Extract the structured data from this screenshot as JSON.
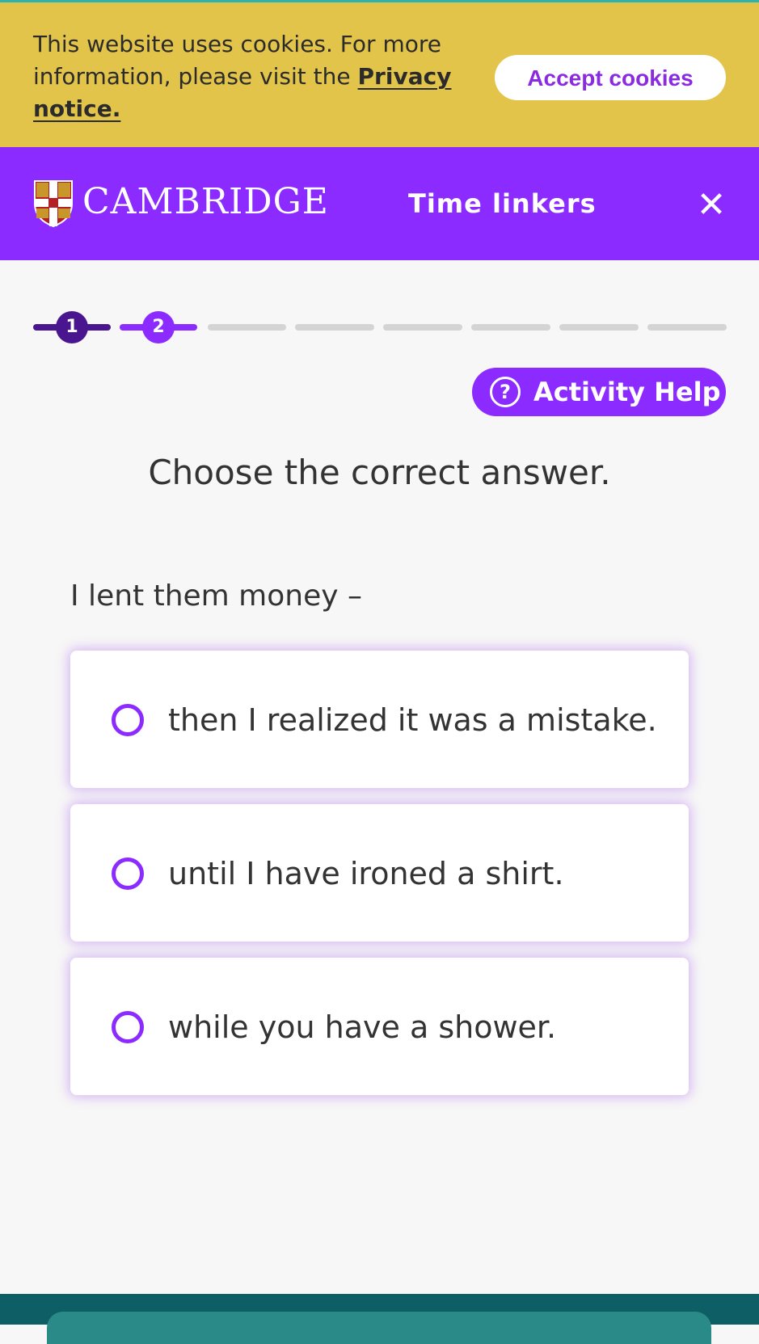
{
  "cookie_banner": {
    "text_prefix": "This website uses cookies. For more information, please visit the ",
    "link_label": "Privacy notice.",
    "accept_label": "Accept cookies"
  },
  "header": {
    "brand": "CAMBRIDGE",
    "title": "Time linkers",
    "close_icon": "close-icon"
  },
  "progress": {
    "steps": [
      "1",
      "2"
    ],
    "current_step": 2,
    "total_segments": 8
  },
  "help": {
    "label": "Activity Help",
    "icon_glyph": "?"
  },
  "activity": {
    "instruction": "Choose the correct answer.",
    "question": "I lent them money –",
    "options": [
      "then I realized it was a mistake.",
      "until I have ironed a shirt.",
      "while you have a shower."
    ]
  },
  "colors": {
    "accent": "#8b2bff",
    "done": "#4a1690",
    "cookie_bg": "#e3c44b",
    "footer": "#0e5e66"
  }
}
